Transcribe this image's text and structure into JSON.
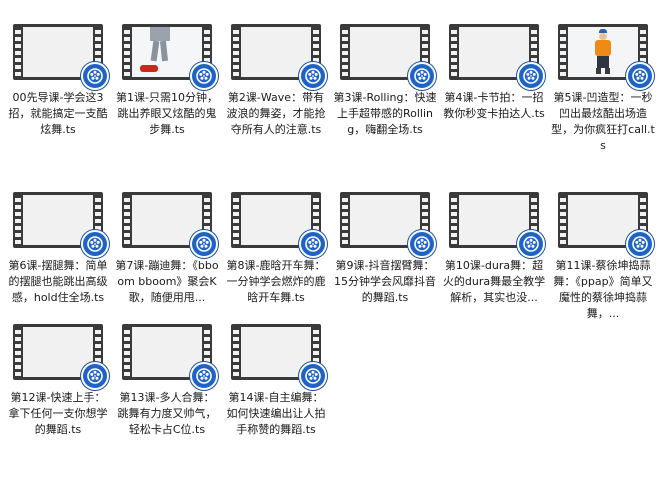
{
  "accent_color": "#1f63c6",
  "files": [
    {
      "name": "00先导课-学会这3招，就能搞定一支酷炫舞.ts",
      "thumbnail": "blank"
    },
    {
      "name": "第1课-只需10分钟，跳出养眼又炫酷的鬼步舞.ts",
      "thumbnail": "dancer-legs"
    },
    {
      "name": "第2课-Wave：带有波浪的舞姿，才能抢夺所有人的注意.ts",
      "thumbnail": "blank"
    },
    {
      "name": "第3课-Rolling：快速上手超带感的Rolling，嗨翻全场.ts",
      "thumbnail": "blank"
    },
    {
      "name": "第4课-卡节拍：一招教你秒变卡拍达人.ts",
      "thumbnail": "blank"
    },
    {
      "name": "第5课-凹造型：一秒凹出最炫酷出场造型，为你疯狂打call.ts",
      "thumbnail": "dancer-orange"
    },
    {
      "name": "第6课-摆腿舞：简单的摆腿也能跳出高级感，hold住全场.ts",
      "thumbnail": "blank"
    },
    {
      "name": "第7课-蹦迪舞：《bboom bboom》聚会K歌，随便用甩...",
      "thumbnail": "blank"
    },
    {
      "name": "第8课-鹿晗开车舞：一分钟学会燃炸的鹿晗开车舞.ts",
      "thumbnail": "blank"
    },
    {
      "name": "第9课-抖音摆臂舞：15分钟学会风靡抖音的舞蹈.ts",
      "thumbnail": "blank"
    },
    {
      "name": "第10课-dura舞：超火的dura舞最全教学解析，其实也没...",
      "thumbnail": "blank"
    },
    {
      "name": "第11课-蔡徐坤捣蒜舞：《ppap》简单又魔性的蔡徐坤捣蒜舞，...",
      "thumbnail": "blank"
    },
    {
      "name": "第12课-快速上手：拿下任何一支你想学的舞蹈.ts",
      "thumbnail": "blank"
    },
    {
      "name": "第13课-多人合舞：跳舞有力度又帅气，轻松卡占C位.ts",
      "thumbnail": "blank"
    },
    {
      "name": "第14课-自主编舞：如何快速编出让人拍手称赞的舞蹈.ts",
      "thumbnail": "blank"
    }
  ]
}
